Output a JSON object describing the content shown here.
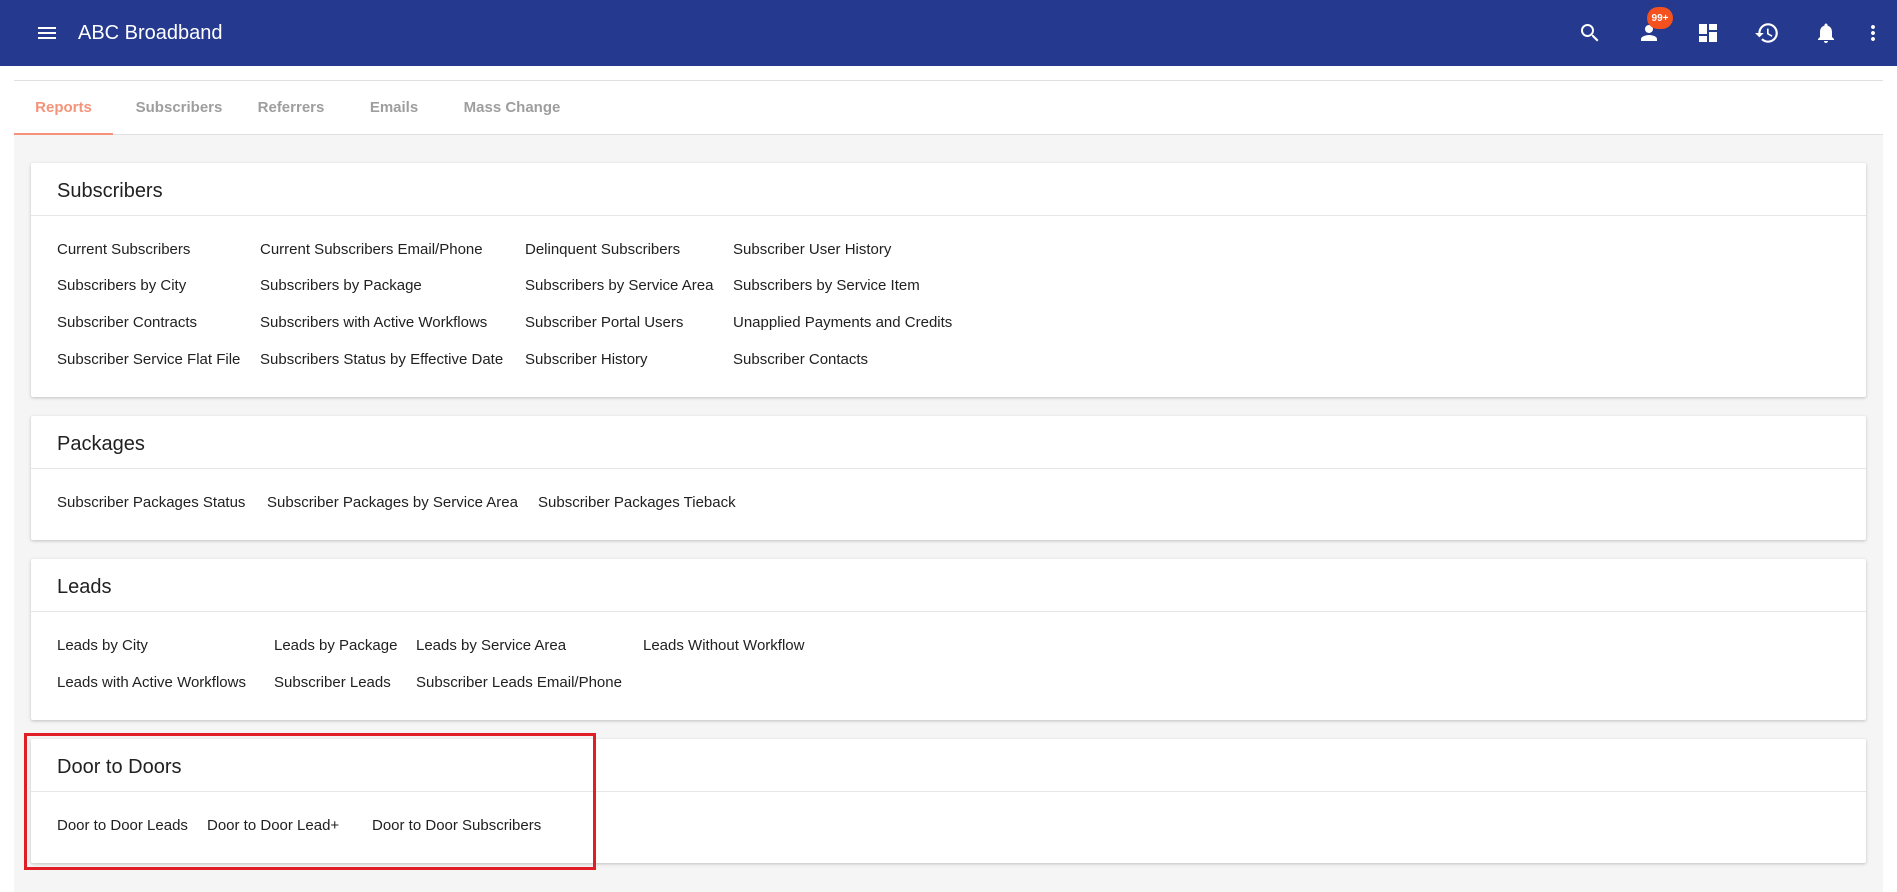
{
  "header": {
    "title": "ABC Broadband",
    "badge": "99+",
    "icons": [
      "menu-icon",
      "search-icon",
      "user-icon",
      "dashboard-icon",
      "history-icon",
      "bell-icon",
      "more-vert-icon"
    ]
  },
  "tabs": [
    "Reports",
    "Subscribers",
    "Referrers",
    "Emails",
    "Mass Change"
  ],
  "sections": {
    "subscribers": {
      "title": "Subscribers",
      "links": [
        "Current Subscribers",
        "Current Subscribers Email/Phone",
        "Delinquent Subscribers",
        "Subscriber User History",
        "Subscribers by City",
        "Subscribers by Package",
        "Subscribers by Service Area",
        "Subscribers by Service Item",
        "Subscriber Contracts",
        "Subscribers with Active Workflows",
        "Subscriber Portal Users",
        "Unapplied Payments and Credits",
        "Subscriber Service Flat File",
        "Subscribers Status by Effective Date",
        "Subscriber History",
        "Subscriber Contacts"
      ]
    },
    "packages": {
      "title": "Packages",
      "links": [
        "Subscriber Packages Status",
        "Subscriber Packages by Service Area",
        "Subscriber Packages Tieback"
      ]
    },
    "leads": {
      "title": "Leads",
      "links": [
        "Leads by City",
        "Leads by Package",
        "Leads by Service Area",
        "Leads Without Workflow",
        "Leads with Active Workflows",
        "Subscriber Leads",
        "Subscriber Leads Email/Phone"
      ]
    },
    "door_to_doors": {
      "title": "Door to Doors",
      "links": [
        "Door to Door Leads",
        "Door to Door Lead+",
        "Door to Door Subscribers"
      ]
    }
  },
  "colors": {
    "header_bg": "#253a8e",
    "active_tab": "#f4937a",
    "badge": "#f4511e",
    "highlight_box": "#e01e26"
  }
}
